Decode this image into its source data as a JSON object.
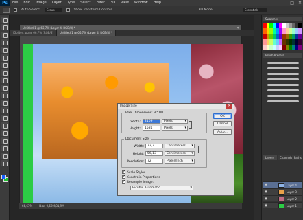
{
  "menubar": {
    "logo": "Ps",
    "items": [
      "File",
      "Edit",
      "Image",
      "Layer",
      "Type",
      "Select",
      "Filter",
      "3D",
      "View",
      "Window",
      "Help"
    ],
    "window_controls": [
      "—",
      "□",
      "✕"
    ]
  },
  "options": {
    "auto_select_label": "Auto-Select:",
    "auto_select_value": "Group",
    "show_transform_label": "Show Transform Controls",
    "mode_label": "3D Mode:",
    "workspace": "Essentials"
  },
  "document": {
    "title": "Untitled-1 @ 66,7% (Layer 4, RGB/8) *",
    "tabs": [
      "Untitled-1 @ 66,7% (Layer 4, RGB/8) *",
      "iGolden.jpg @ 66,7% (RGB/8)",
      "Untitled-1 @ 66,7% (Layer 4, RGB/8) *"
    ],
    "status_zoom": "66,67%",
    "status_doc": "Doc: 9,69M/31,9M"
  },
  "panels": {
    "swatches_tab": "Swatches",
    "brush_presets_tab": "Brush Presets",
    "layers_tab": "Layers",
    "channels_tab": "Channels",
    "paths_tab": "Paths",
    "layers": [
      {
        "name": "Layer 4",
        "selected": true
      },
      {
        "name": "Layer 3",
        "selected": false
      },
      {
        "name": "Layer 2",
        "selected": false
      },
      {
        "name": "Layer 1",
        "selected": false
      }
    ],
    "swatch_colors": [
      "#ff0000",
      "#ffff00",
      "#00ff00",
      "#00ffff",
      "#0000ff",
      "#ff00ff",
      "#ffffff",
      "#cccccc",
      "#999999",
      "#666666",
      "#333333",
      "#000000",
      "#ff6600",
      "#ffcc00",
      "#99ff00",
      "#00ff99",
      "#0099ff",
      "#9900ff",
      "#ff99cc",
      "#ffcc99",
      "#ccff99",
      "#99ffcc",
      "#99ccff",
      "#cc99ff",
      "#cc0000",
      "#cc9900",
      "#66cc00",
      "#00cc66",
      "#0066cc",
      "#6600cc",
      "#993300",
      "#996600",
      "#339900",
      "#009966",
      "#003399",
      "#660099",
      "#ff9999",
      "#ffcc66",
      "#ccff66",
      "#66ffcc",
      "#66ccff",
      "#cc66ff",
      "#663300",
      "#333300",
      "#003300",
      "#003333",
      "#000033",
      "#330033",
      "#ffcccc",
      "#ffffcc",
      "#ccffcc",
      "#ccffff",
      "#ccccff",
      "#ffccff",
      "#800000",
      "#808000",
      "#008000",
      "#008080",
      "#000080",
      "#800080"
    ]
  },
  "dialog": {
    "title": "Image Size",
    "close": "✕",
    "pixel_dimensions": "Pixel Dimensions: 9,51M",
    "pixel_width_label": "Width:",
    "pixel_width_value": "2109",
    "pixel_width_unit": "Pixels",
    "pixel_height_label": "Height:",
    "pixel_height_value": "1581",
    "pixel_height_unit": "Pixels",
    "document_size_legend": "Document Size:",
    "doc_width_label": "Width:",
    "doc_width_value": "73,7",
    "doc_width_unit": "Centimeters",
    "doc_height_label": "Height:",
    "doc_height_value": "56,13",
    "doc_height_unit": "Centimeters",
    "resolution_label": "Resolution:",
    "resolution_value": "72",
    "resolution_unit": "Pixels/Inch",
    "scale_styles": "Scale Styles",
    "constrain_proportions": "Constrain Proportions",
    "resample_image": "Resample Image:",
    "resample_method": "Bicubic Automatic",
    "ok": "OK",
    "cancel": "Cancel",
    "auto": "Auto..."
  }
}
